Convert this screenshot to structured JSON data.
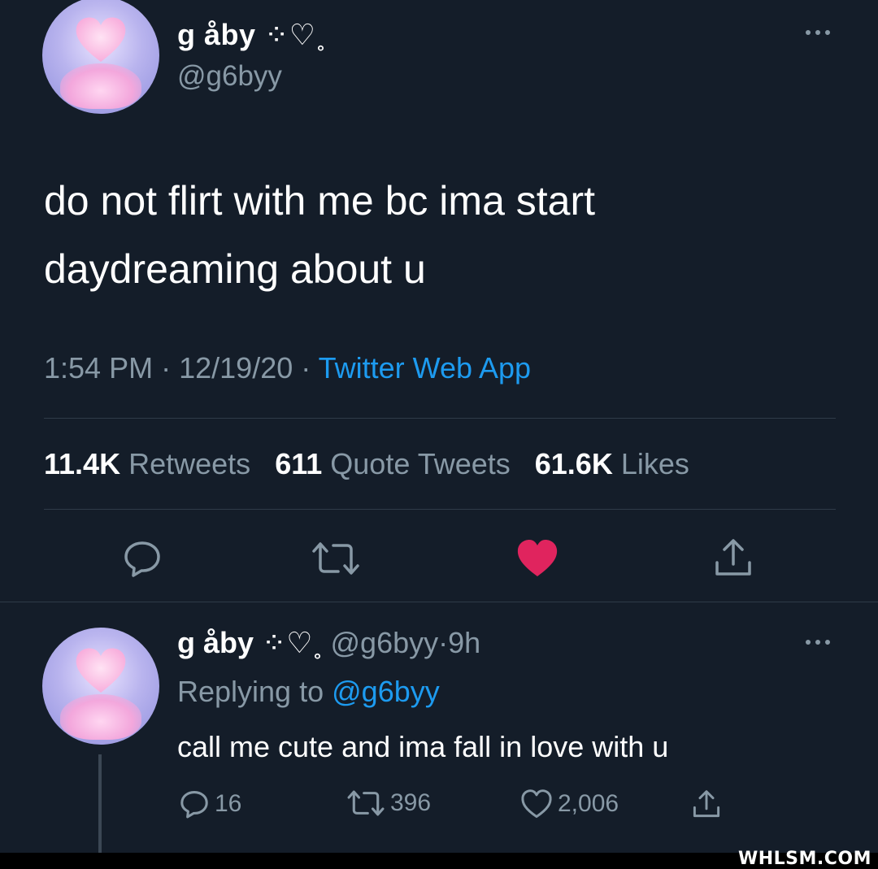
{
  "tweet": {
    "display_name": "g åby",
    "name_symbols": "⁘♡˳",
    "handle": "@g6byy",
    "text_line1": "do not flirt with me bc ima start",
    "text_line2": "daydreaming about u",
    "time": "1:54 PM",
    "date": "12/19/20",
    "separator": "·",
    "source": "Twitter Web App",
    "retweets_count": "11.4K",
    "retweets_label": "Retweets",
    "quotes_count": "611",
    "quotes_label": "Quote Tweets",
    "likes_count": "61.6K",
    "likes_label": "Likes",
    "liked": true
  },
  "reply": {
    "display_name": "g åby",
    "name_symbols": "⁘♡˳",
    "handle": "@g6byy",
    "age": "9h",
    "separator": "·",
    "replying_label": "Replying to",
    "replying_handle": "@g6byy",
    "text": "call me cute and ima fall in love with u",
    "reply_count": "16",
    "retweet_count": "396",
    "like_count": "2,006"
  },
  "watermark": "WHLSM.COM",
  "colors": {
    "background": "#141d29",
    "secondary_text": "#8899a6",
    "link": "#1d9bf0",
    "like": "#e0245e"
  },
  "icons": [
    "ellipsis-icon",
    "reply-icon",
    "retweet-icon",
    "heart-filled-icon",
    "share-icon",
    "heart-outline-icon"
  ]
}
